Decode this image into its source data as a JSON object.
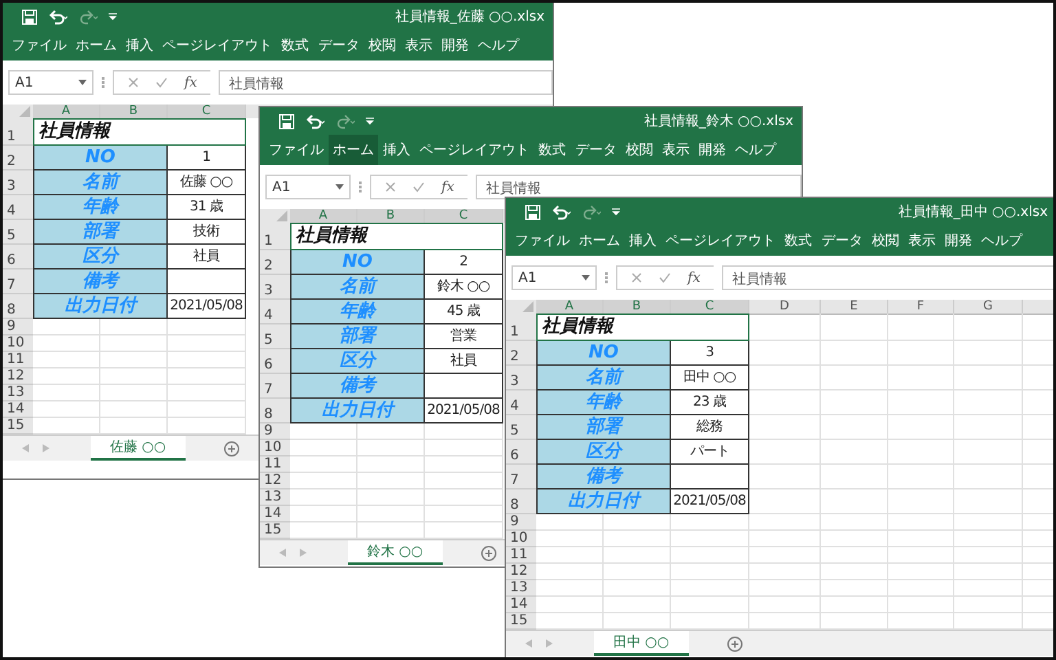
{
  "windows": [
    {
      "title": "社員情報_佐藤 ○○.xlsx",
      "ribbon_tabs": [
        {
          "label": "ファイル",
          "selected": false
        },
        {
          "label": "ホーム",
          "selected": false
        },
        {
          "label": "挿入",
          "selected": false
        },
        {
          "label": "ページレイアウト",
          "selected": false
        },
        {
          "label": "数式",
          "selected": false
        },
        {
          "label": "データ",
          "selected": false
        },
        {
          "label": "校閲",
          "selected": false
        },
        {
          "label": "表示",
          "selected": false
        },
        {
          "label": "開発",
          "selected": false
        },
        {
          "label": "ヘルプ",
          "selected": false
        }
      ],
      "formula_bar": {
        "name_box": "A1",
        "function_label": "fx",
        "formula": "社員情報"
      },
      "columns": [
        {
          "label": "A",
          "selected": true
        },
        {
          "label": "B",
          "selected": true
        },
        {
          "label": "C",
          "selected": true
        }
      ],
      "row_numbers": [
        "1",
        "2",
        "3",
        "4",
        "5",
        "6",
        "7",
        "8",
        "9",
        "10",
        "11",
        "12",
        "13",
        "14",
        "15"
      ],
      "sheet": {
        "title": "社員情報",
        "fields": [
          {
            "label": "NO",
            "value": "1"
          },
          {
            "label": "名前",
            "value": "佐藤 ○○"
          },
          {
            "label": "年齢",
            "value": "31 歳"
          },
          {
            "label": "部署",
            "value": "技術"
          },
          {
            "label": "区分",
            "value": "社員"
          },
          {
            "label": "備考"
          },
          {
            "label": "出力日付",
            "value": "2021/05/08"
          }
        ]
      },
      "sheet_tabs": [
        {
          "label": "佐藤 ○○",
          "selected": true
        }
      ]
    },
    {
      "title": "社員情報_鈴木 ○○.xlsx",
      "ribbon_tabs": [
        {
          "label": "ファイル",
          "selected": false
        },
        {
          "label": "ホーム",
          "selected": true
        },
        {
          "label": "挿入",
          "selected": false
        },
        {
          "label": "ページレイアウト",
          "selected": false
        },
        {
          "label": "数式",
          "selected": false
        },
        {
          "label": "データ",
          "selected": false
        },
        {
          "label": "校閲",
          "selected": false
        },
        {
          "label": "表示",
          "selected": false
        },
        {
          "label": "開発",
          "selected": false
        },
        {
          "label": "ヘルプ",
          "selected": false
        }
      ],
      "formula_bar": {
        "name_box": "A1",
        "function_label": "fx",
        "formula": "社員情報"
      },
      "columns": [
        {
          "label": "A",
          "selected": true
        },
        {
          "label": "B",
          "selected": true
        },
        {
          "label": "C",
          "selected": true
        }
      ],
      "row_numbers": [
        "1",
        "2",
        "3",
        "4",
        "5",
        "6",
        "7",
        "8",
        "9",
        "10",
        "11",
        "12",
        "13",
        "14",
        "15"
      ],
      "sheet": {
        "title": "社員情報",
        "fields": [
          {
            "label": "NO",
            "value": "2"
          },
          {
            "label": "名前",
            "value": "鈴木 ○○"
          },
          {
            "label": "年齢",
            "value": "45 歳"
          },
          {
            "label": "部署",
            "value": "営業"
          },
          {
            "label": "区分",
            "value": "社員"
          },
          {
            "label": "備考"
          },
          {
            "label": "出力日付",
            "value": "2021/05/08"
          }
        ]
      },
      "sheet_tabs": [
        {
          "label": "鈴木 ○○",
          "selected": true
        }
      ]
    },
    {
      "title": "社員情報_田中 ○○.xlsx",
      "ribbon_tabs": [
        {
          "label": "ファイル",
          "selected": false
        },
        {
          "label": "ホーム",
          "selected": false
        },
        {
          "label": "挿入",
          "selected": false
        },
        {
          "label": "ページレイアウト",
          "selected": false
        },
        {
          "label": "数式",
          "selected": false
        },
        {
          "label": "データ",
          "selected": false
        },
        {
          "label": "校閲",
          "selected": false
        },
        {
          "label": "表示",
          "selected": false
        },
        {
          "label": "開発",
          "selected": false
        },
        {
          "label": "ヘルプ",
          "selected": false
        }
      ],
      "formula_bar": {
        "name_box": "A1",
        "function_label": "fx",
        "formula": "社員情報"
      },
      "columns": [
        {
          "label": "A",
          "selected": true
        },
        {
          "label": "B",
          "selected": true
        },
        {
          "label": "C",
          "selected": true
        },
        {
          "label": "D",
          "selected": false
        },
        {
          "label": "E",
          "selected": false
        },
        {
          "label": "F",
          "selected": false
        },
        {
          "label": "G",
          "selected": false
        }
      ],
      "row_numbers": [
        "1",
        "2",
        "3",
        "4",
        "5",
        "6",
        "7",
        "8",
        "9",
        "10",
        "11",
        "12",
        "13",
        "14",
        "15"
      ],
      "sheet": {
        "title": "社員情報",
        "fields": [
          {
            "label": "NO",
            "value": "3"
          },
          {
            "label": "名前",
            "value": "田中 ○○"
          },
          {
            "label": "年齢",
            "value": "23 歳"
          },
          {
            "label": "部署",
            "value": "総務"
          },
          {
            "label": "区分",
            "value": "パート"
          },
          {
            "label": "備考"
          },
          {
            "label": "出力日付",
            "value": "2021/05/08"
          }
        ]
      },
      "sheet_tabs": [
        {
          "label": "田中 ○○",
          "selected": true
        }
      ]
    }
  ]
}
